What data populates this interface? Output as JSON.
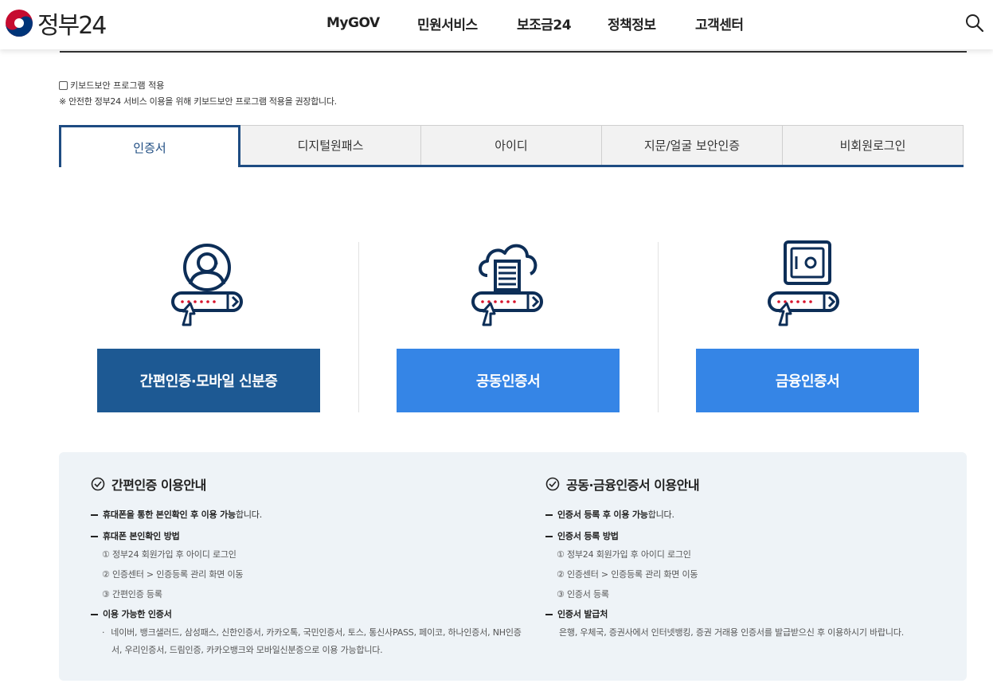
{
  "header": {
    "logo_text": "정부24",
    "nav": [
      "MyGOV",
      "민원서비스",
      "보조금24",
      "정책정보",
      "고객센터"
    ],
    "search_icon": "search-icon"
  },
  "keyboard": {
    "checkbox_label": "키보드보안 프로그램 적용",
    "checked": false,
    "note": "※ 안전한 정부24 서비스 이용을 위해 키보드보안 프로그램 적용을 권장합니다."
  },
  "tabs": [
    "인증서",
    "디지털원패스",
    "아이디",
    "지문/얼굴 보안인증",
    "비회원로그인"
  ],
  "active_tab": "인증서",
  "cards": [
    {
      "icon": "person-login-icon",
      "label": "간편인증·모바일 신분증",
      "color": "#1d5993"
    },
    {
      "icon": "cloud-server-login-icon",
      "label": "공동인증서",
      "color": "#3585e6"
    },
    {
      "icon": "safe-login-icon",
      "label": "금융인증서",
      "color": "#3585e6"
    }
  ],
  "guide": {
    "left": {
      "title": "간편인증 이용안내",
      "line1_bold": "휴대폰을 통한 본인확인 후 이용 가능",
      "line1_rest": "합니다.",
      "line2": "휴대폰 본인확인 방법",
      "steps": [
        "① 정부24 회원가입 후 아이디 로그인",
        "② 인증센터 > 인증등록 관리 화면 이동",
        "③ 간편인증 등록"
      ],
      "line3": "이용 가능한 인증서",
      "providers_1": "네이버, 뱅크샐러드, 삼성패스, 신한인증서, 카카오톡, 국민인증서, 토스, 통신사PASS, 페이코, 하나인증서, NH인증",
      "providers_2": "서, 우리인증서, 드림인증, 카카오뱅크와 모바일신분증으로 이용 가능합니다."
    },
    "right": {
      "title": "공동·금융인증서 이용안내",
      "line1_bold": "인증서 등록 후 이용 가능",
      "line1_rest": "합니다.",
      "line2": "인증서 등록 방법",
      "steps": [
        "① 정부24 회원가입 후 아이디 로그인",
        "② 인증센터 > 인증등록 관리 화면 이동",
        "③ 인증서 등록"
      ],
      "line3": "인증서 발급처",
      "issuer_text": "은행, 우체국, 증권사에서 인터넷뱅킹, 증권 거래용 인증서를 발급받으신 후 이용하시기 바랍니다."
    }
  }
}
